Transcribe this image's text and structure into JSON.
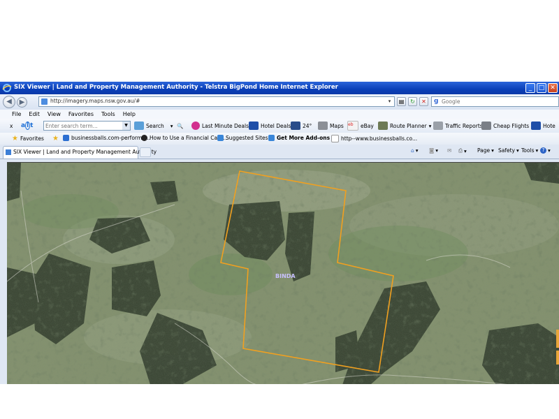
{
  "window": {
    "title": "SIX Viewer | Land and Property Management Authority - Telstra BigPond Home Internet Explorer"
  },
  "address": {
    "url": "http://imagery.maps.nsw.gov.au/#"
  },
  "search": {
    "placeholder": "Google"
  },
  "menu": {
    "items": [
      "File",
      "Edit",
      "View",
      "Favorites",
      "Tools",
      "Help"
    ]
  },
  "toolbar": {
    "close_label": "x",
    "search_placeholder": "Enter search term...",
    "search_label": "Search",
    "items": [
      "Last Minute Deals",
      "Hotel Deals",
      "24°",
      "Maps",
      "eBay",
      "Route Planner",
      "Traffic Reports",
      "Cheap Flights",
      "Hote"
    ]
  },
  "favorites": {
    "label": "Favorites",
    "links": [
      "businessballs.com-performa...",
      "How to Use a Financial Calc...",
      "Suggested Sites",
      "Get More Add-ons",
      "http--www.businessballs.co..."
    ]
  },
  "tabs": {
    "active": "SIX Viewer | Land and Property Management Authority"
  },
  "commandbar": {
    "page": "Page",
    "safety": "Safety",
    "tools": "Tools"
  },
  "map": {
    "label": "BINDA",
    "boundary_color": "#f0a020",
    "label_color": "#c8c0ff"
  }
}
